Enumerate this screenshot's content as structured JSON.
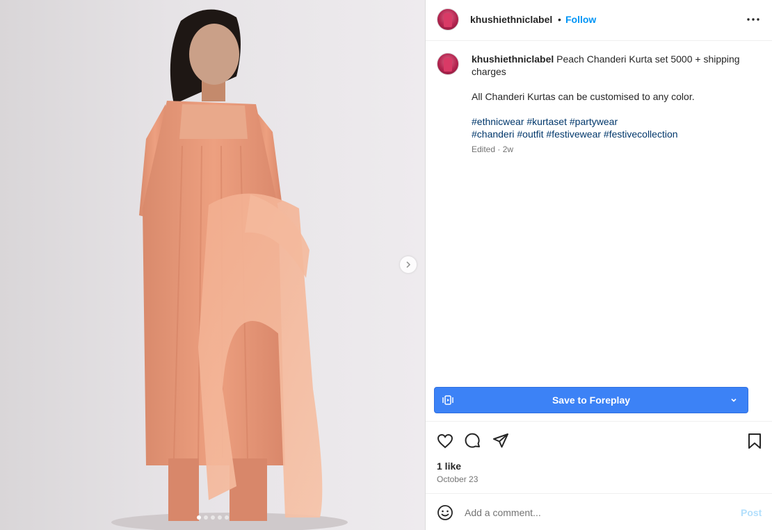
{
  "post": {
    "username": "khushiethniclabel",
    "separator": "•",
    "follow_label": "Follow",
    "caption_username": "khushiethniclabel",
    "caption_text": "Peach Chanderi Kurta set 5000 + shipping charges",
    "caption_line2": "All Chanderi Kurtas can be customised to any color.",
    "hashtags_line1": [
      "#ethnicwear",
      "#kurtaset",
      "#partywear"
    ],
    "hashtags_line2": [
      "#chanderi",
      "#outfit",
      "#festivewear",
      "#festivecollection"
    ],
    "meta": "Edited · 2w"
  },
  "carousel": {
    "slide_count": 5,
    "active_index": 0
  },
  "save_button": {
    "label": "Save to Foreplay",
    "color": "#3c82f6"
  },
  "actions": {
    "icons": [
      "heart-icon",
      "comment-icon",
      "share-icon",
      "bookmark-icon"
    ]
  },
  "engagement": {
    "likes": "1 like",
    "date": "October 23"
  },
  "comment": {
    "placeholder": "Add a comment...",
    "post_label": "Post"
  },
  "colors": {
    "link": "#0095f6",
    "hashtag": "#00376b",
    "muted": "#737373",
    "post_disabled": "#b2dffc"
  }
}
